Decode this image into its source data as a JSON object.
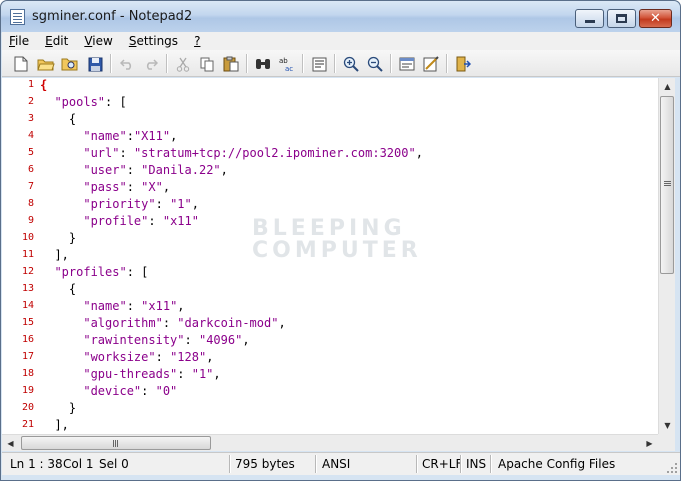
{
  "window": {
    "title": "sgminer.conf - Notepad2",
    "icon": "notepad-document-icon"
  },
  "menu": [
    {
      "underline": "F",
      "rest": "ile"
    },
    {
      "underline": "E",
      "rest": "dit"
    },
    {
      "underline": "V",
      "rest": "iew"
    },
    {
      "underline": "S",
      "rest": "ettings"
    },
    {
      "underline": "?",
      "rest": ""
    }
  ],
  "toolbar": {
    "icons": [
      "new-icon",
      "open-icon",
      "browse-icon",
      "save-icon",
      "undo-icon",
      "redo-icon",
      "cut-icon",
      "copy-icon",
      "paste-icon",
      "find-icon",
      "replace-icon",
      "word-wrap-icon",
      "zoom-in-icon",
      "zoom-out-icon",
      "scheme-icon",
      "customize-icon",
      "exit-icon"
    ]
  },
  "editor": {
    "line_numbers": [
      "1",
      "2",
      "3",
      "4",
      "5",
      "6",
      "7",
      "8",
      "9",
      "10",
      "11",
      "12",
      "13",
      "14",
      "15",
      "16",
      "17",
      "18",
      "19",
      "20",
      "21"
    ],
    "lines": [
      "{",
      "  \"pools\": [",
      "    {",
      "      \"name\":\"X11\",",
      "      \"url\": \"stratum+tcp://pool2.ipominer.com:3200\",",
      "      \"user\": \"Danila.22\",",
      "      \"pass\": \"X\",",
      "      \"priority\": \"1\",",
      "      \"profile\": \"x11\"",
      "    }",
      "  ],",
      "  \"profiles\": [",
      "    {",
      "      \"name\": \"x11\",",
      "      \"algorithm\": \"darkcoin-mod\",",
      "      \"rawintensity\": \"4096\",",
      "      \"worksize\": \"128\",",
      "      \"gpu-threads\": \"1\",",
      "      \"device\": \"0\"",
      "    }",
      "  ],"
    ],
    "watermark_line1": "BLEEPING",
    "watermark_line2": "COMPUTER",
    "colors": {
      "line_number": "#c00000",
      "string": "#8b008b",
      "brace_highlight": "#d00000"
    }
  },
  "statusbar": {
    "position": "Ln 1 : 38",
    "column": "Col 1",
    "selection": "Sel 0",
    "size": "795 bytes",
    "encoding": "ANSI",
    "line_endings": "CR+LF",
    "insert_mode": "INS",
    "scheme": "Apache Config Files"
  }
}
